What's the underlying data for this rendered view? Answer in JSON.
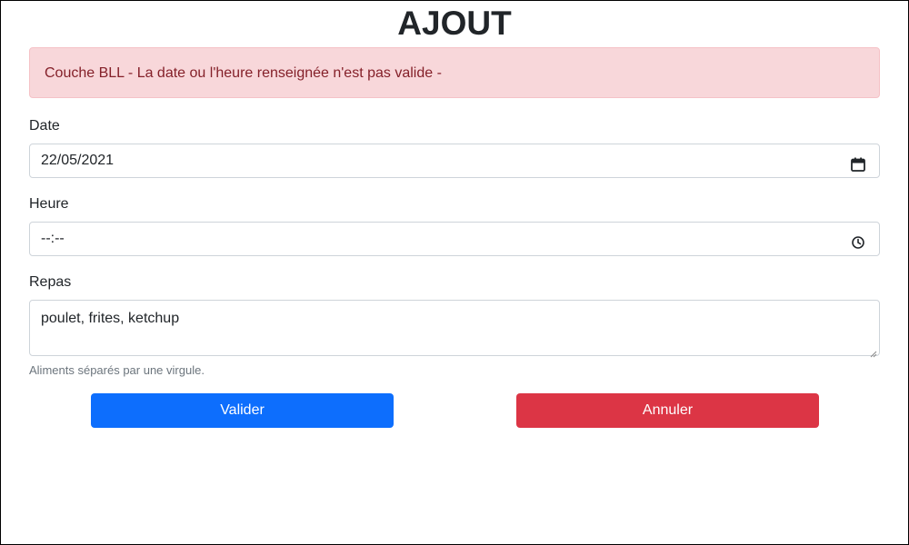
{
  "page": {
    "title": "AJOUT"
  },
  "alert": {
    "message": "Couche BLL - La date ou l'heure renseignée n'est pas valide -"
  },
  "form": {
    "date": {
      "label": "Date",
      "value": "22/05/2021",
      "icon": "calendar-icon"
    },
    "time": {
      "label": "Heure",
      "value": "--:--",
      "icon": "clock-icon"
    },
    "meal": {
      "label": "Repas",
      "value": "poulet, frites, ketchup",
      "help": "Aliments séparés par une virgule."
    }
  },
  "actions": {
    "submit_label": "Valider",
    "cancel_label": "Annuler"
  },
  "colors": {
    "primary": "#0d6efd",
    "danger": "#dc3545",
    "alert_bg": "#f8d7da",
    "alert_text": "#842029"
  }
}
